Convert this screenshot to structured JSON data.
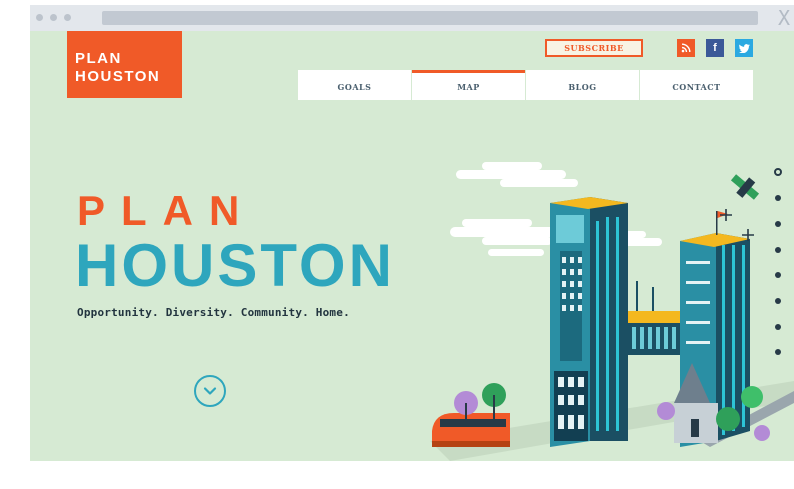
{
  "colors": {
    "accent": "#f05a28",
    "teal": "#2ea6bd",
    "page_bg": "#d6ead3",
    "dark": "#273a47"
  },
  "browser": {
    "close_glyph": "X"
  },
  "logo": {
    "line1": "PLAN",
    "line2": "HOUSTON"
  },
  "header": {
    "subscribe_label": "SUBSCRIBE",
    "social": [
      {
        "name": "rss",
        "glyph": "∷"
      },
      {
        "name": "facebook",
        "glyph": "f"
      },
      {
        "name": "twitter",
        "glyph": "✦"
      }
    ]
  },
  "nav": {
    "items": [
      {
        "label": "GOALS"
      },
      {
        "label": "MAP"
      },
      {
        "label": "BLOG"
      },
      {
        "label": "CONTACT"
      }
    ],
    "active_index": 1
  },
  "hero": {
    "title_line1": "PLAN",
    "title_line2": "HOUSTON",
    "tagline": "Opportunity. Diversity. Community. Home."
  },
  "slider": {
    "count": 8,
    "active_index": 0
  },
  "icons": {
    "scroll_down": "chevron-down-circle-icon",
    "illustration": "houston-skyline-illustration"
  }
}
